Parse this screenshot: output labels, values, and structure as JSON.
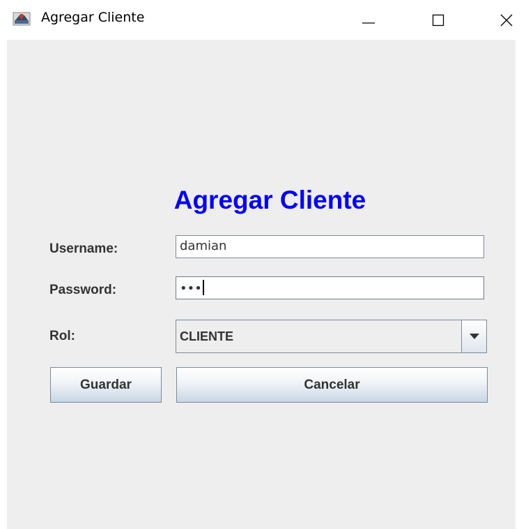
{
  "window": {
    "title": "Agregar Cliente",
    "icon": "java-app-icon",
    "controls": [
      "minimize-icon",
      "maximize-icon",
      "close-icon"
    ]
  },
  "form": {
    "heading": "Agregar Cliente",
    "heading_color": "#0000ff",
    "username": {
      "label": "Username:",
      "value": "damian"
    },
    "password": {
      "label": "Password:",
      "masked_value": "•••"
    },
    "rol": {
      "label": "Rol:",
      "selected": "CLIENTE"
    },
    "buttons": {
      "save": "Guardar",
      "cancel": "Cancelar"
    }
  },
  "colors": {
    "client_background": "#eeeeee",
    "text": "#333333",
    "border": "#7a8a99"
  }
}
